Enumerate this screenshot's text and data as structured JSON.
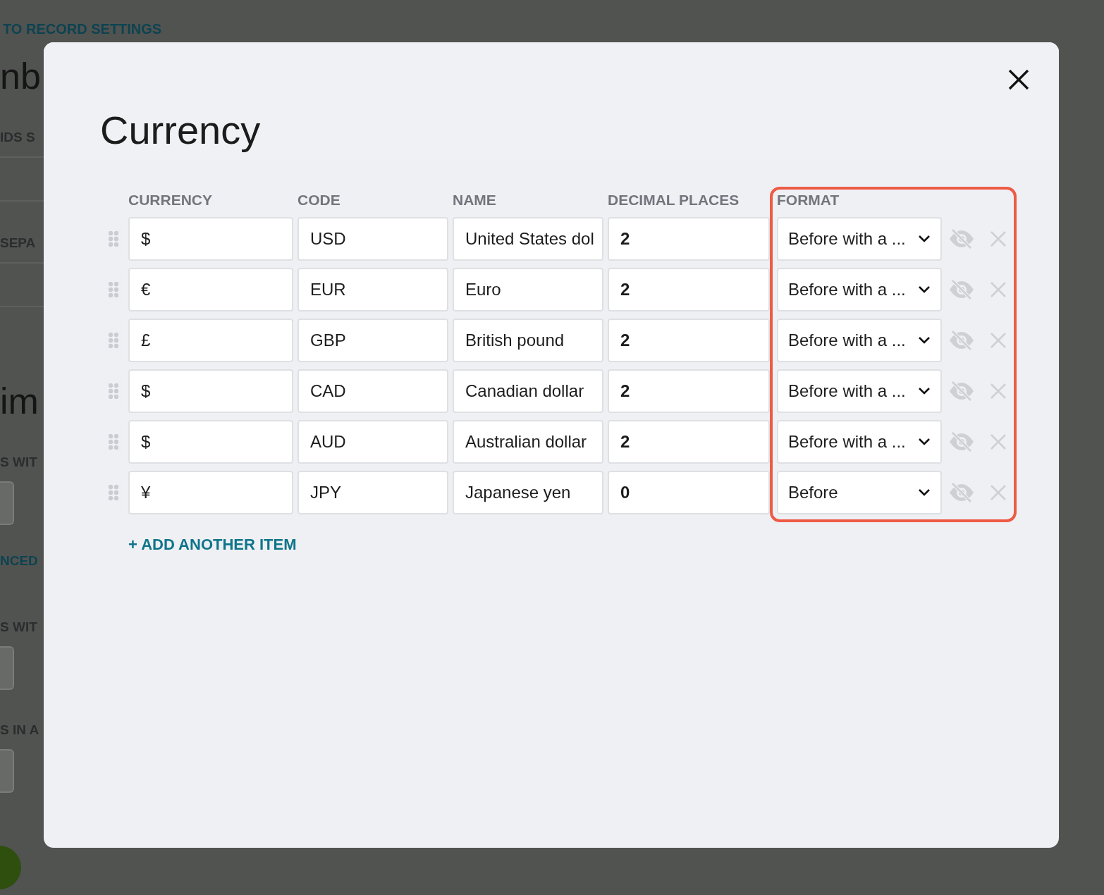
{
  "background_page": {
    "back_link": "TO RECORD SETTINGS",
    "texts": [
      {
        "kind": "heading",
        "text": "nb"
      },
      {
        "kind": "label",
        "text": "IDS S"
      },
      {
        "kind": "field"
      },
      {
        "kind": "label",
        "text": "SEPA"
      },
      {
        "kind": "field"
      },
      {
        "kind": "heading",
        "text": "im"
      },
      {
        "kind": "label",
        "text": "S WIT"
      },
      {
        "kind": "box"
      },
      {
        "kind": "link",
        "text": "NCED"
      },
      {
        "kind": "label",
        "text": "S WIT"
      },
      {
        "kind": "box"
      },
      {
        "kind": "label",
        "text": "S IN A"
      },
      {
        "kind": "box"
      }
    ]
  },
  "dialog": {
    "title": "Currency",
    "columns": [
      "CURRENCY",
      "CODE",
      "NAME",
      "DECIMAL PLACES",
      "FORMAT"
    ],
    "rows": [
      {
        "currency": "$",
        "code": "USD",
        "name": "United States dol",
        "decimal_places": "2",
        "format": "Before with a ..."
      },
      {
        "currency": "€",
        "code": "EUR",
        "name": "Euro",
        "decimal_places": "2",
        "format": "Before with a ..."
      },
      {
        "currency": "£",
        "code": "GBP",
        "name": "British pound",
        "decimal_places": "2",
        "format": "Before with a ..."
      },
      {
        "currency": "$",
        "code": "CAD",
        "name": "Canadian dollar",
        "decimal_places": "2",
        "format": "Before with a ..."
      },
      {
        "currency": "$",
        "code": "AUD",
        "name": "Australian dollar",
        "decimal_places": "2",
        "format": "Before with a ..."
      },
      {
        "currency": "¥",
        "code": "JPY",
        "name": "Japanese yen",
        "decimal_places": "0",
        "format": "Before"
      }
    ],
    "add_button": "+ ADD ANOTHER ITEM"
  }
}
